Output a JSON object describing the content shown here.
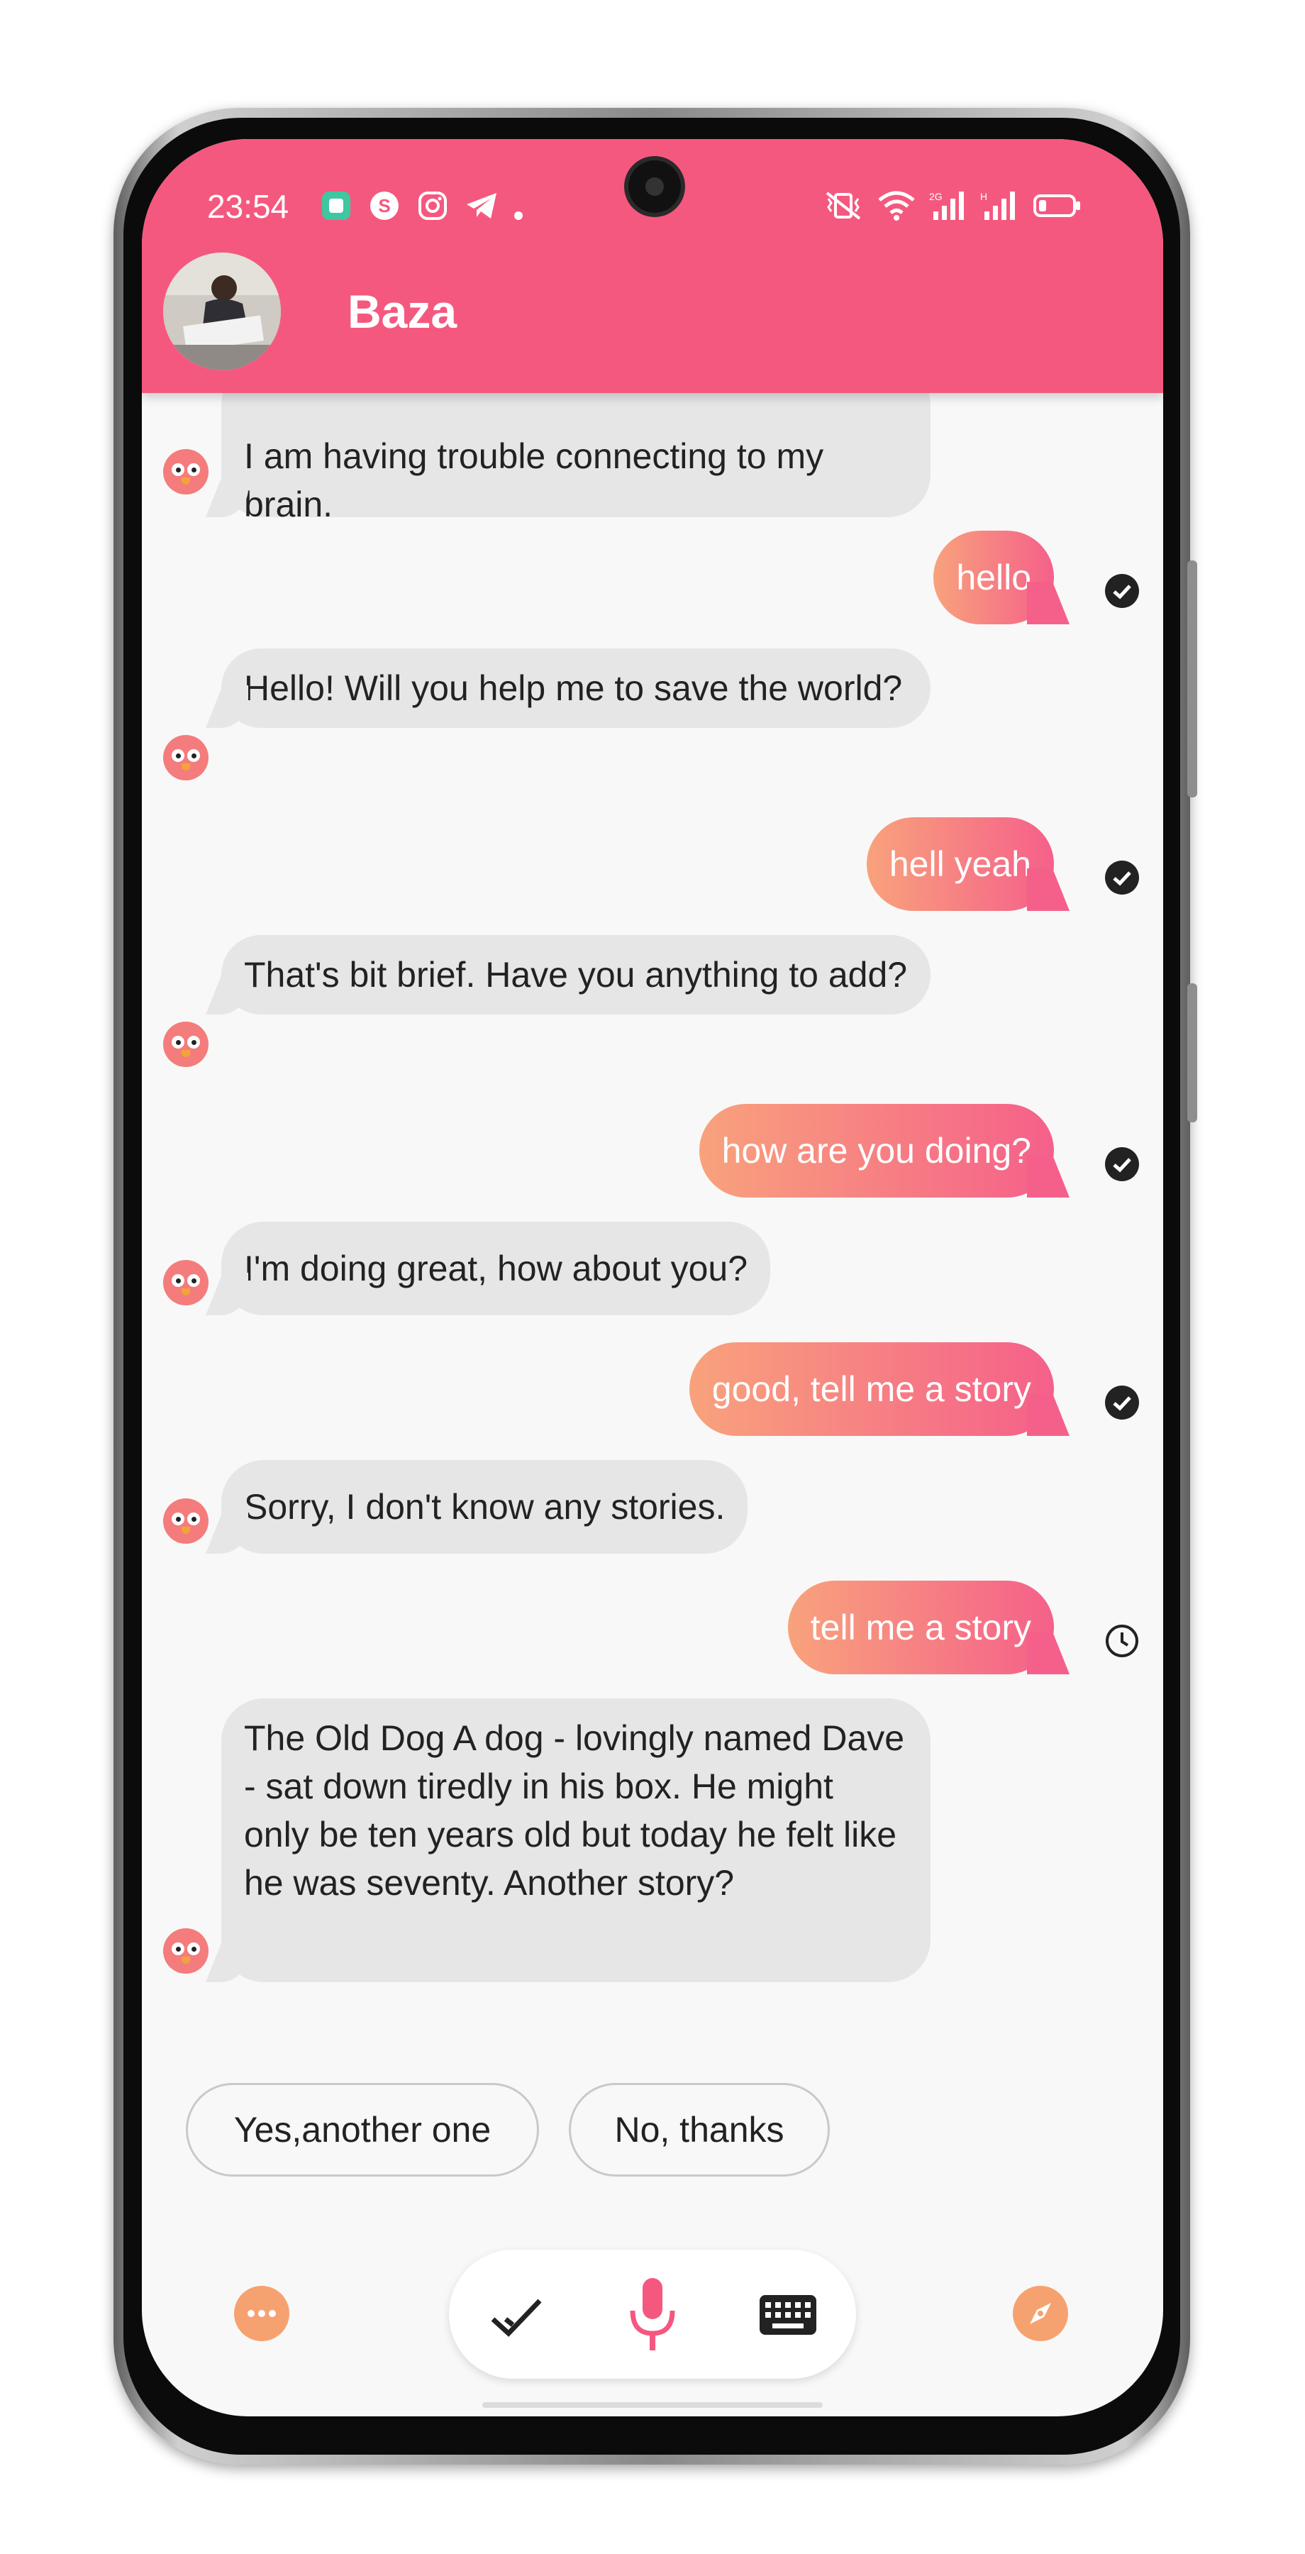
{
  "status_bar": {
    "time": "23:54",
    "left_icons": [
      "app-notification-icon",
      "skype-icon",
      "instagram-icon",
      "telegram-icon",
      "dot-icon"
    ],
    "right_icons": [
      "vibrate-icon",
      "wifi-icon",
      "signal-2g-icon",
      "signal-h-icon",
      "battery-icon"
    ],
    "sub_labels": {
      "sig1": "2G",
      "sig2": "H"
    }
  },
  "header": {
    "title": "Baza",
    "accent_color": "#f5587f"
  },
  "messages": [
    {
      "from": "bot",
      "text": "I am having trouble connecting to my brain."
    },
    {
      "from": "user",
      "text": "hello",
      "status": "delivered"
    },
    {
      "from": "bot",
      "text": "Hello! Will you help me to save the world?"
    },
    {
      "from": "user",
      "text": "hell yeah",
      "status": "delivered"
    },
    {
      "from": "bot",
      "text": "That's bit brief. Have you anything to add?"
    },
    {
      "from": "user",
      "text": "how are you doing?",
      "status": "delivered"
    },
    {
      "from": "bot",
      "text": "I'm doing great, how about you?"
    },
    {
      "from": "user",
      "text": "good, tell me a story",
      "status": "delivered"
    },
    {
      "from": "bot",
      "text": "Sorry, I don't know any stories."
    },
    {
      "from": "user",
      "text": "tell me a story",
      "status": "pending"
    },
    {
      "from": "bot",
      "text": "The Old Dog A dog - lovingly named Dave - sat down tiredly in his box. He might only be ten years old but today he felt like he was seventy.   Another story?"
    }
  ],
  "quick_replies": [
    "Yes,another one",
    "No, thanks"
  ],
  "toolbar": {
    "left_icon": "more-icon",
    "center_icons": [
      "checkmark-icon",
      "microphone-icon",
      "keyboard-icon"
    ],
    "right_icon": "compass-icon"
  },
  "colors": {
    "user_gradient_start": "#f8a27c",
    "user_gradient_end": "#f5608a",
    "bot_bubble": "#e6e6e6"
  }
}
